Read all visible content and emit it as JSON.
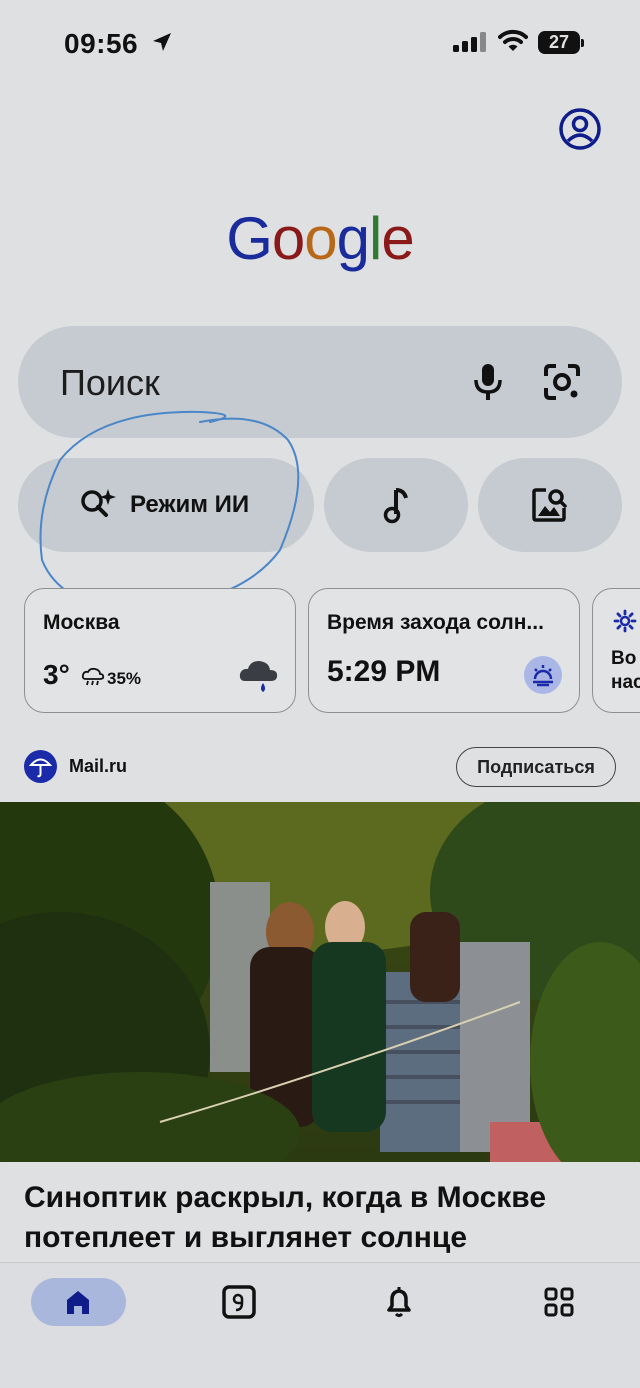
{
  "status_bar": {
    "time": "09:56",
    "battery": "27"
  },
  "logo": {
    "letters": [
      "G",
      "o",
      "o",
      "g",
      "l",
      "e"
    ],
    "colors": [
      "#1a2b9c",
      "#8a1a1a",
      "#b86818",
      "#1a2b9c",
      "#2e7a2e",
      "#8a1a1a"
    ]
  },
  "search": {
    "placeholder": "Поиск"
  },
  "chips": {
    "ai_mode": "Режим ИИ"
  },
  "cards": {
    "weather": {
      "city": "Москва",
      "temperature": "3°",
      "precipitation": "35%"
    },
    "sunset": {
      "title": "Время захода солн...",
      "time": "5:29 PM"
    },
    "third": {
      "text_line1": "Во",
      "text_line2": "нас"
    }
  },
  "feed": {
    "source": "Mail.ru",
    "subscribe_label": "Подписаться",
    "headline": "Синоптик раскрыл, когда в Москве потеплеет и выглянет солнце"
  },
  "colors": {
    "accent": "#1a2aa8",
    "chip_bg": "#c5cbd0",
    "page_bg": "#dfe0e2",
    "home_pill": "#a9b7dc"
  }
}
